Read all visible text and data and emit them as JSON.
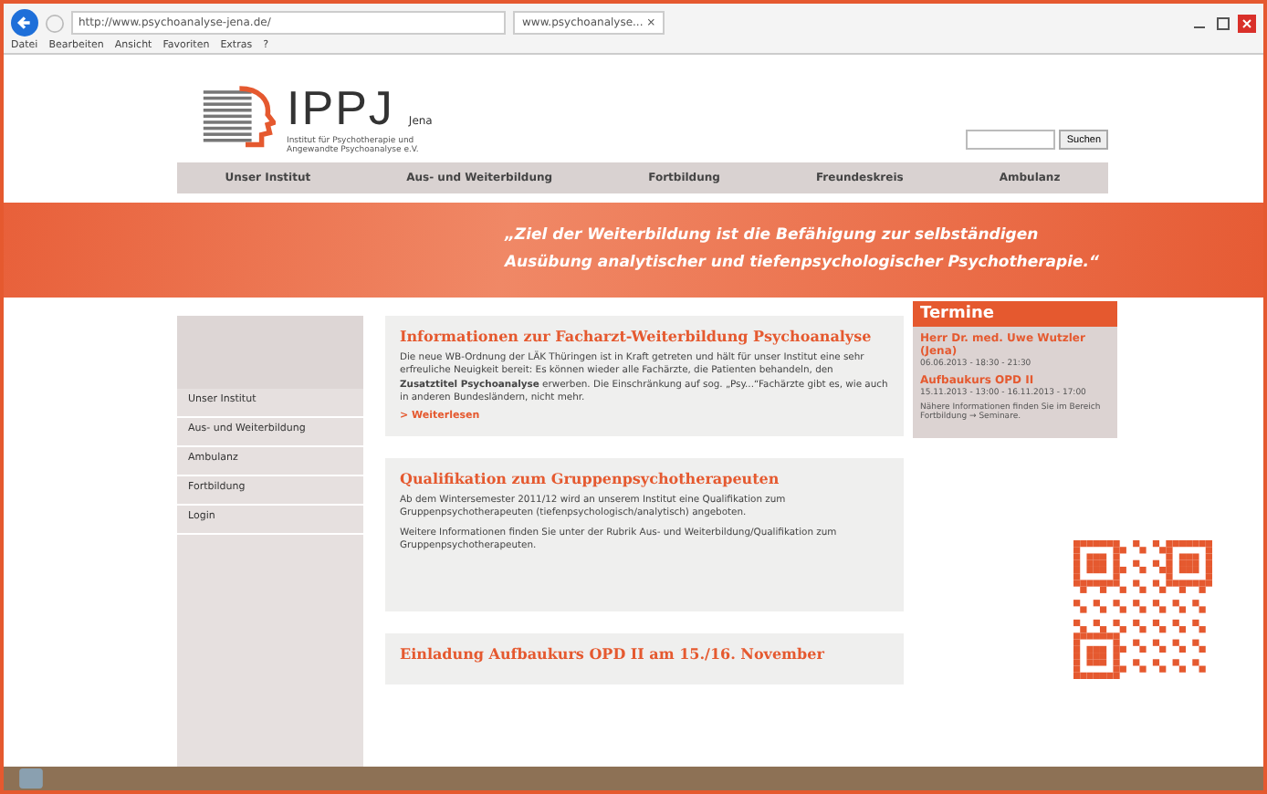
{
  "browser": {
    "address": "http://www.psychoanalyse-jena.de/",
    "tab": "www.psychoanalyse...",
    "tab_close": "×",
    "menu": [
      "Datei",
      "Bearbeiten",
      "Ansicht",
      "Favoriten",
      "Extras",
      "?"
    ]
  },
  "header": {
    "logo": "IPPJ",
    "city": "Jena",
    "subtitle": [
      "Institut für Psychotherapie und",
      "Angewandte Psychoanalyse e.V."
    ],
    "search_button": "Suchen"
  },
  "nav": [
    {
      "label": "Unser Institut"
    },
    {
      "label": "Aus- und Weiterbildung"
    },
    {
      "label": "Fortbildung"
    },
    {
      "label": "Freundeskreis"
    },
    {
      "label": "Ambulanz"
    }
  ],
  "banner": [
    "„Ziel der Weiterbildung ist die Befähigung zur selbständigen",
    "Ausübung analytischer und tiefenpsychologischer Psychotherapie.“"
  ],
  "sidebar": {
    "items": [
      "Unser Institut",
      "Aus- und Weiterbildung",
      "Ambulanz",
      "Fortbildung",
      "Login"
    ]
  },
  "articles": [
    {
      "title": "Informationen zur Facharzt-Weiterbildung Psychoanalyse",
      "paragraphs": [
        "Die neue WB-Ordnung der LÄK Thüringen ist in Kraft getreten und hält für unser Institut eine sehr erfreuliche Neuigkeit bereit: Es können wieder alle Fachärzte, die Patienten behandeln, den **Zusatztitel Psychoanalyse** erwerben. Die Einschränkung auf sog. „Psy...“Fachärzte gibt es, wie auch in anderen Bundesländern, nicht mehr."
      ],
      "link": "> Weiterlesen"
    },
    {
      "title": "Qualifikation zum Gruppenpsychotherapeuten",
      "paragraphs": [
        "Ab dem Wintersemester 2011/12 wird an unserem Institut eine Qualifikation zum Gruppenpsychotherapeuten (tiefenpsychologisch/analytisch) angeboten.",
        "Weitere Informationen finden Sie unter der Rubrik Aus- und Weiterbildung/Qualifikation zum Gruppenpsychotherapeuten."
      ]
    },
    {
      "title": "Einladung Aufbaukurs OPD II am 15./16. November"
    }
  ],
  "termine": {
    "title": "Termine",
    "events": [
      {
        "title": "Herr Dr. med. Uwe Wutzler (Jena)",
        "date": "06.06.2013 - 18:30 - 21:30"
      },
      {
        "title": "Aufbaukurs OPD II",
        "date": "15.11.2013 - 13:00 - 16.11.2013 - 17:00"
      }
    ],
    "note": "Nähere Informationen finden Sie im Bereich Fortbildung → Seminare."
  }
}
